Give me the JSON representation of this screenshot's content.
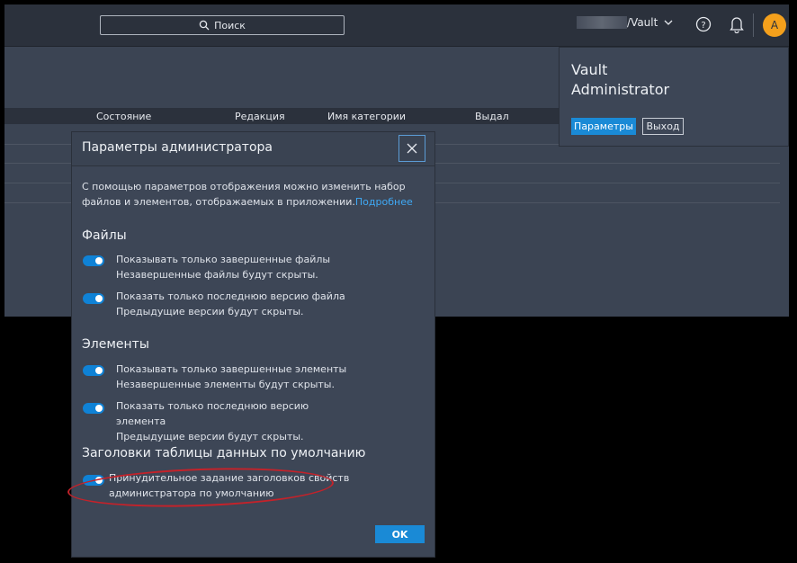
{
  "topbar": {
    "search_label": "Поиск",
    "vault_path": "/Vault",
    "avatar_letter": "A"
  },
  "table": {
    "columns": [
      "Состояние",
      "Редакция",
      "Имя категории",
      "Выдал"
    ]
  },
  "user_menu": {
    "name_line1": "Vault",
    "name_line2": "Administrator",
    "params_button": "Параметры",
    "logout_button": "Выход"
  },
  "dialog": {
    "title": "Параметры администратора",
    "intro": "С помощью параметров отображения можно изменить набор файлов и элементов, отображаемых в приложении.",
    "intro_link": "Подробнее",
    "files_section": "Файлы",
    "files_opt1_title": "Показывать только завершенные файлы",
    "files_opt1_desc": "Незавершенные файлы будут скрыты.",
    "files_opt2_title": "Показать только последнюю версию файла",
    "files_opt2_desc": "Предыдущие версии будут скрыты.",
    "items_section": "Элементы",
    "items_opt1_title": "Показывать только завершенные элементы",
    "items_opt1_desc": "Незавершенные элементы будут скрыты.",
    "items_opt2_title_a": "Показать только последнюю версию",
    "items_opt2_title_b": "элемента",
    "items_opt2_desc": "Предыдущие версии будут скрыты.",
    "headers_section": "Заголовки таблицы данных по умолчанию",
    "headers_opt1_a": "Принудительное задание заголовков свойств",
    "headers_opt1_b": "администратора по умолчанию",
    "ok_button": "OK"
  },
  "toggles": {
    "files_opt1": true,
    "files_opt2": true,
    "items_opt1": true,
    "items_opt2": true,
    "headers_opt1": true
  },
  "colors": {
    "accent": "#1a8ad6",
    "avatar": "#f4a01c",
    "highlight_circle": "#c4222a"
  }
}
